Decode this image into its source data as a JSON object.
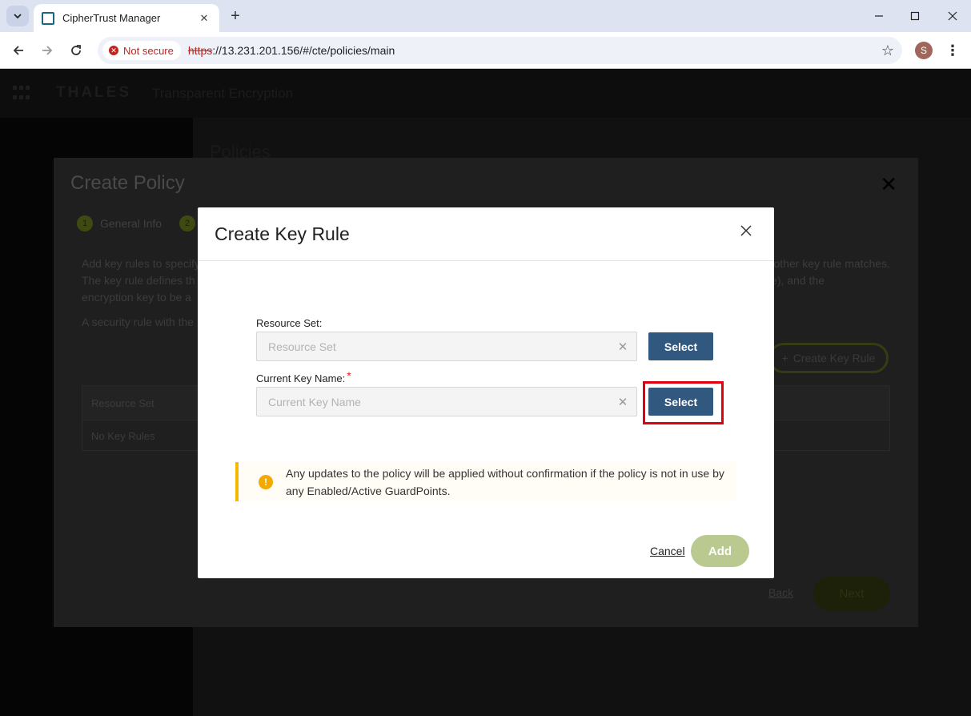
{
  "browser": {
    "tab_title": "CipherTrust Manager",
    "security_label": "Not secure",
    "url_scheme": "https",
    "url_rest": "://13.231.201.156/#/cte/policies/main",
    "profile_initial": "S"
  },
  "app": {
    "brand": "THALES",
    "product": "Transparent Encryption",
    "page_title": "Policies"
  },
  "wizard": {
    "title": "Create Policy",
    "steps": [
      {
        "num": "1",
        "label": "General Info"
      },
      {
        "num": "2",
        "label": ""
      }
    ],
    "description_line1": "Add key rules to specify",
    "description_line1_end": "other key rule matches.",
    "description_line2": "The key rule defines th",
    "description_line2_end": "e), and the",
    "description_line3": "encryption key to be a",
    "description2": "A security rule with the",
    "create_key_rule_label": "Create Key Rule",
    "table_header": "Resource Set",
    "table_empty": "No Key Rules",
    "back_label": "Back",
    "next_label": "Next"
  },
  "modal": {
    "title": "Create Key Rule",
    "resource_set_label": "Resource Set:",
    "resource_set_placeholder": "Resource Set",
    "current_key_label": "Current Key Name:",
    "required_mark": "*",
    "current_key_placeholder": "Current Key Name",
    "select_label": "Select",
    "alert_text": "Any updates to the policy will be applied without confirmation if the policy is not in use by any Enabled/Active GuardPoints.",
    "cancel_label": "Cancel",
    "add_label": "Add"
  },
  "colors": {
    "primary_button": "#31587e",
    "add_button_disabled": "#b9c98f",
    "warning": "#f2aa00",
    "highlight": "#e0000f"
  }
}
